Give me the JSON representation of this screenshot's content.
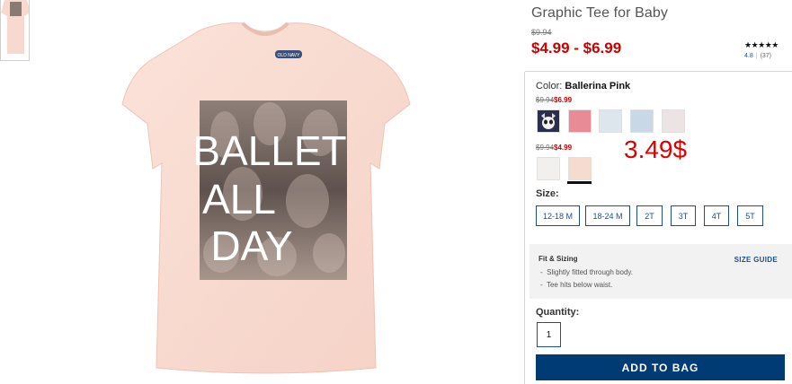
{
  "product": {
    "title": "Graphic Tee for Baby",
    "original_price": "$9.94",
    "price_range": "$4.99 - $6.99"
  },
  "rating": {
    "stars": "★★★★★",
    "score": "4.8",
    "count": "(37)"
  },
  "image": {
    "graphic_text": [
      "BALLET",
      "ALL",
      "DAY"
    ],
    "tag_text": "OLD NAVY"
  },
  "color": {
    "label": "Color:",
    "selected": "Ballerina Pink",
    "group1_was": "$9.94",
    "group1_now": "$6.99",
    "group2_was": "$9.94",
    "group2_now": "$4.99",
    "group1_swatches": [
      "#2b2f4a",
      "#e88b95",
      "#dde6ec",
      "#c9d8e6",
      "#ece4e4"
    ],
    "group2_swatches": [
      "#f1f0ee",
      "#f6dccf"
    ]
  },
  "annotation": "3.49$",
  "size": {
    "label": "Size:",
    "options": [
      "12-18 M",
      "18-24 M",
      "2T",
      "3T",
      "4T",
      "5T"
    ]
  },
  "fit": {
    "title": "Fit & Sizing",
    "items": [
      "Slightly fitted through body.",
      "Tee hits below waist."
    ],
    "guide_label": "SIZE GUIDE"
  },
  "quantity": {
    "label": "Quantity:",
    "value": "1"
  },
  "actions": {
    "add_to_bag": "ADD TO BAG"
  },
  "colors": {
    "price_red": "#cc0000",
    "navy": "#003b73",
    "link_blue": "#1f4f8a",
    "shirt_pink": "#f8d9cf"
  }
}
